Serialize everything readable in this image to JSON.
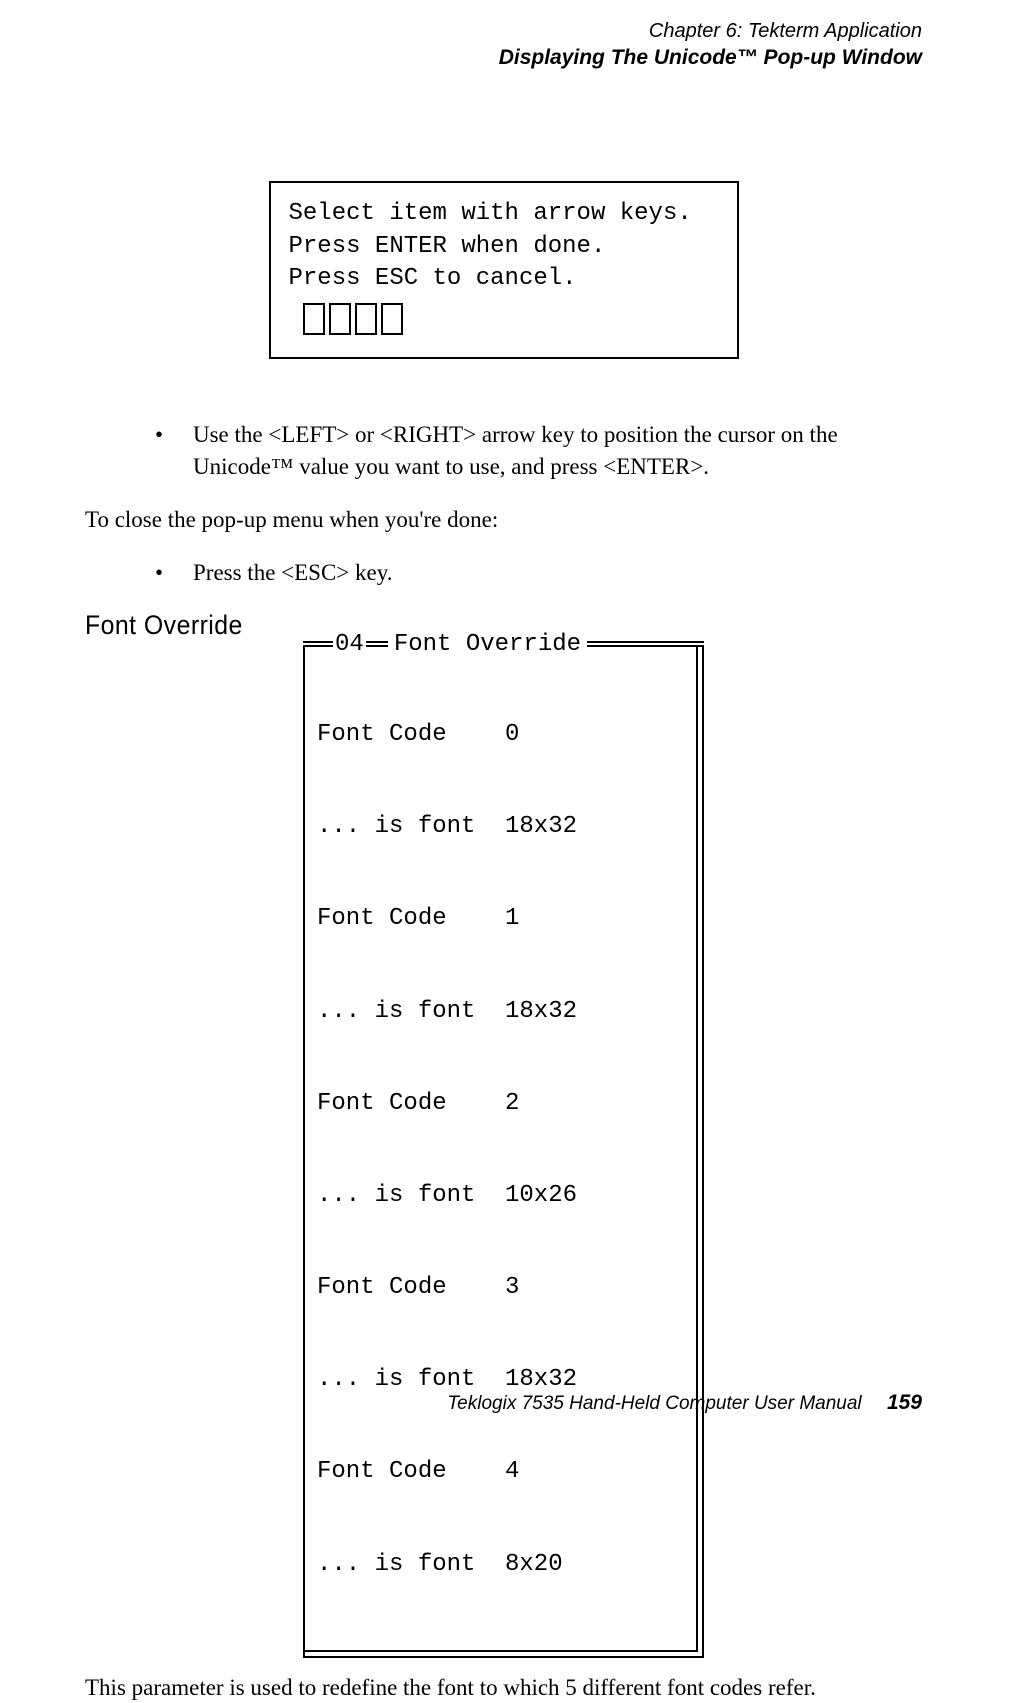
{
  "header": {
    "chapter": "Chapter 6: Tekterm Application",
    "section": "Displaying The Unicode™ Pop-up Window"
  },
  "popup": {
    "line1": "Select item with arrow keys.",
    "line2": "Press ENTER when done.",
    "line3": "Press ESC to cancel."
  },
  "bullet1": "Use the <LEFT> or <RIGHT> arrow key to position the cursor on the Unicode™ value you want to use, and press <ENTER>.",
  "para_close": "To close the pop-up menu when you're done:",
  "bullet2": "Press the <ESC> key.",
  "section_heading": "Font Override",
  "font_override": {
    "num": "04",
    "title": "Font Override",
    "rows": [
      {
        "label": "Font Code",
        "value": "0"
      },
      {
        "label": "... is font",
        "value": "18x32"
      },
      {
        "label": "Font Code",
        "value": "1"
      },
      {
        "label": "... is font",
        "value": "18x32"
      },
      {
        "label": "Font Code",
        "value": "2"
      },
      {
        "label": "... is font",
        "value": "10x26"
      },
      {
        "label": "Font Code",
        "value": "3"
      },
      {
        "label": "... is font",
        "value": "18x32"
      },
      {
        "label": "Font Code",
        "value": "4"
      },
      {
        "label": "... is font",
        "value": "8x20"
      }
    ]
  },
  "para_redefine": "This parameter is used to redefine the font to which 5 different font codes refer.",
  "footer": {
    "manual": "Teklogix 7535 Hand-Held Computer User Manual",
    "page": "159"
  }
}
